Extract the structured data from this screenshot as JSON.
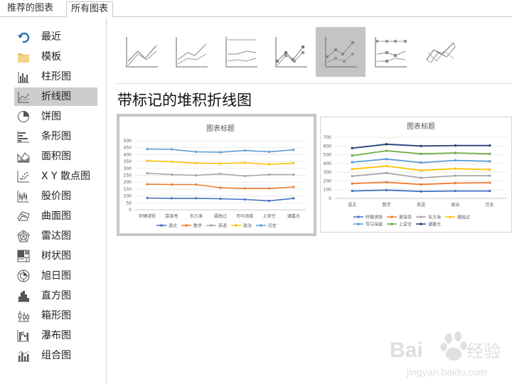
{
  "tabs": [
    {
      "label": "推荐的图表"
    },
    {
      "label": "所有图表"
    }
  ],
  "sidebar": {
    "items": [
      {
        "label": "最近",
        "icon": "recent-arrow-icon"
      },
      {
        "label": "模板",
        "icon": "folder-icon"
      },
      {
        "label": "柱形图",
        "icon": "column-chart-icon"
      },
      {
        "label": "折线图",
        "icon": "line-chart-icon",
        "selected": true
      },
      {
        "label": "饼图",
        "icon": "pie-chart-icon"
      },
      {
        "label": "条形图",
        "icon": "bar-chart-icon"
      },
      {
        "label": "面积图",
        "icon": "area-chart-icon"
      },
      {
        "label": "X Y 散点图",
        "icon": "scatter-chart-icon"
      },
      {
        "label": "股价图",
        "icon": "stock-chart-icon"
      },
      {
        "label": "曲面图",
        "icon": "surface-chart-icon"
      },
      {
        "label": "雷达图",
        "icon": "radar-chart-icon"
      },
      {
        "label": "树状图",
        "icon": "treemap-chart-icon"
      },
      {
        "label": "旭日图",
        "icon": "sunburst-chart-icon"
      },
      {
        "label": "直方图",
        "icon": "histogram-chart-icon"
      },
      {
        "label": "箱形图",
        "icon": "box-whisker-chart-icon"
      },
      {
        "label": "瀑布图",
        "icon": "waterfall-chart-icon"
      },
      {
        "label": "组合图",
        "icon": "combo-chart-icon"
      }
    ]
  },
  "subtypes": [
    {
      "icon": "line-subtype-icon"
    },
    {
      "icon": "stacked-line-subtype-icon"
    },
    {
      "icon": "percent-stacked-line-subtype-icon"
    },
    {
      "icon": "line-markers-subtype-icon"
    },
    {
      "icon": "stacked-line-markers-subtype-icon",
      "selected": true
    },
    {
      "icon": "percent-stacked-line-markers-subtype-icon"
    },
    {
      "icon": "3d-line-subtype-icon"
    }
  ],
  "main": {
    "heading": "带标记的堆积折线图"
  },
  "colors": {
    "blue": "#4472c4",
    "orange": "#ed7d31",
    "gray": "#a5a5a5",
    "gold": "#ffc000",
    "lightblue": "#5b9bd5",
    "green": "#70ad47",
    "navy": "#264478"
  },
  "chart_data": [
    {
      "type": "line",
      "title": "图表标题",
      "categories": [
        "轩辕求败",
        "慕容亮",
        "东方海",
        "諷独过",
        "司马海棠",
        "上官空",
        "谴嘉光"
      ],
      "ylim": [
        0,
        500
      ],
      "yticks": [
        0,
        50,
        100,
        150,
        200,
        250,
        300,
        350,
        400,
        450,
        500
      ],
      "grid": true,
      "legend_position": "bottom",
      "series": [
        {
          "name": "语文",
          "color": "#4472c4",
          "values": [
            85,
            83,
            83,
            80,
            75,
            65,
            83
          ]
        },
        {
          "name": "数学",
          "color": "#ed7d31",
          "values": [
            185,
            183,
            183,
            160,
            155,
            155,
            165
          ]
        },
        {
          "name": "英语",
          "color": "#a5a5a5",
          "values": [
            265,
            255,
            250,
            260,
            245,
            255,
            255
          ]
        },
        {
          "name": "政治",
          "color": "#ffc000",
          "values": [
            355,
            348,
            338,
            335,
            340,
            330,
            338
          ]
        },
        {
          "name": "历史",
          "color": "#5b9bd5",
          "values": [
            440,
            438,
            420,
            417,
            430,
            420,
            435
          ]
        }
      ]
    },
    {
      "type": "line",
      "title": "图表标题",
      "categories": [
        "语文",
        "数学",
        "英语",
        "政治",
        "历史"
      ],
      "ylim": [
        0,
        700
      ],
      "yticks": [
        0,
        100,
        200,
        300,
        400,
        500,
        600,
        700
      ],
      "grid": true,
      "legend_position": "bottom",
      "series": [
        {
          "name": "轩辕求败",
          "color": "#4472c4",
          "values": [
            85,
            95,
            80,
            85,
            85
          ]
        },
        {
          "name": "慕容亮",
          "color": "#ed7d31",
          "values": [
            170,
            185,
            160,
            175,
            180
          ]
        },
        {
          "name": "东方海",
          "color": "#a5a5a5",
          "values": [
            255,
            290,
            235,
            260,
            260
          ]
        },
        {
          "name": "諷独过",
          "color": "#ffc000",
          "values": [
            335,
            370,
            320,
            340,
            330
          ]
        },
        {
          "name": "司马海棠",
          "color": "#5b9bd5",
          "values": [
            415,
            450,
            410,
            435,
            425
          ]
        },
        {
          "name": "上官空",
          "color": "#70ad47",
          "values": [
            490,
            545,
            510,
            520,
            510
          ]
        },
        {
          "name": "谴嘉光",
          "color": "#264478",
          "values": [
            575,
            620,
            600,
            605,
            605
          ]
        }
      ]
    }
  ],
  "watermark": {
    "logo_text": "Bai 经验",
    "url": "jingyan.baidu.com"
  }
}
